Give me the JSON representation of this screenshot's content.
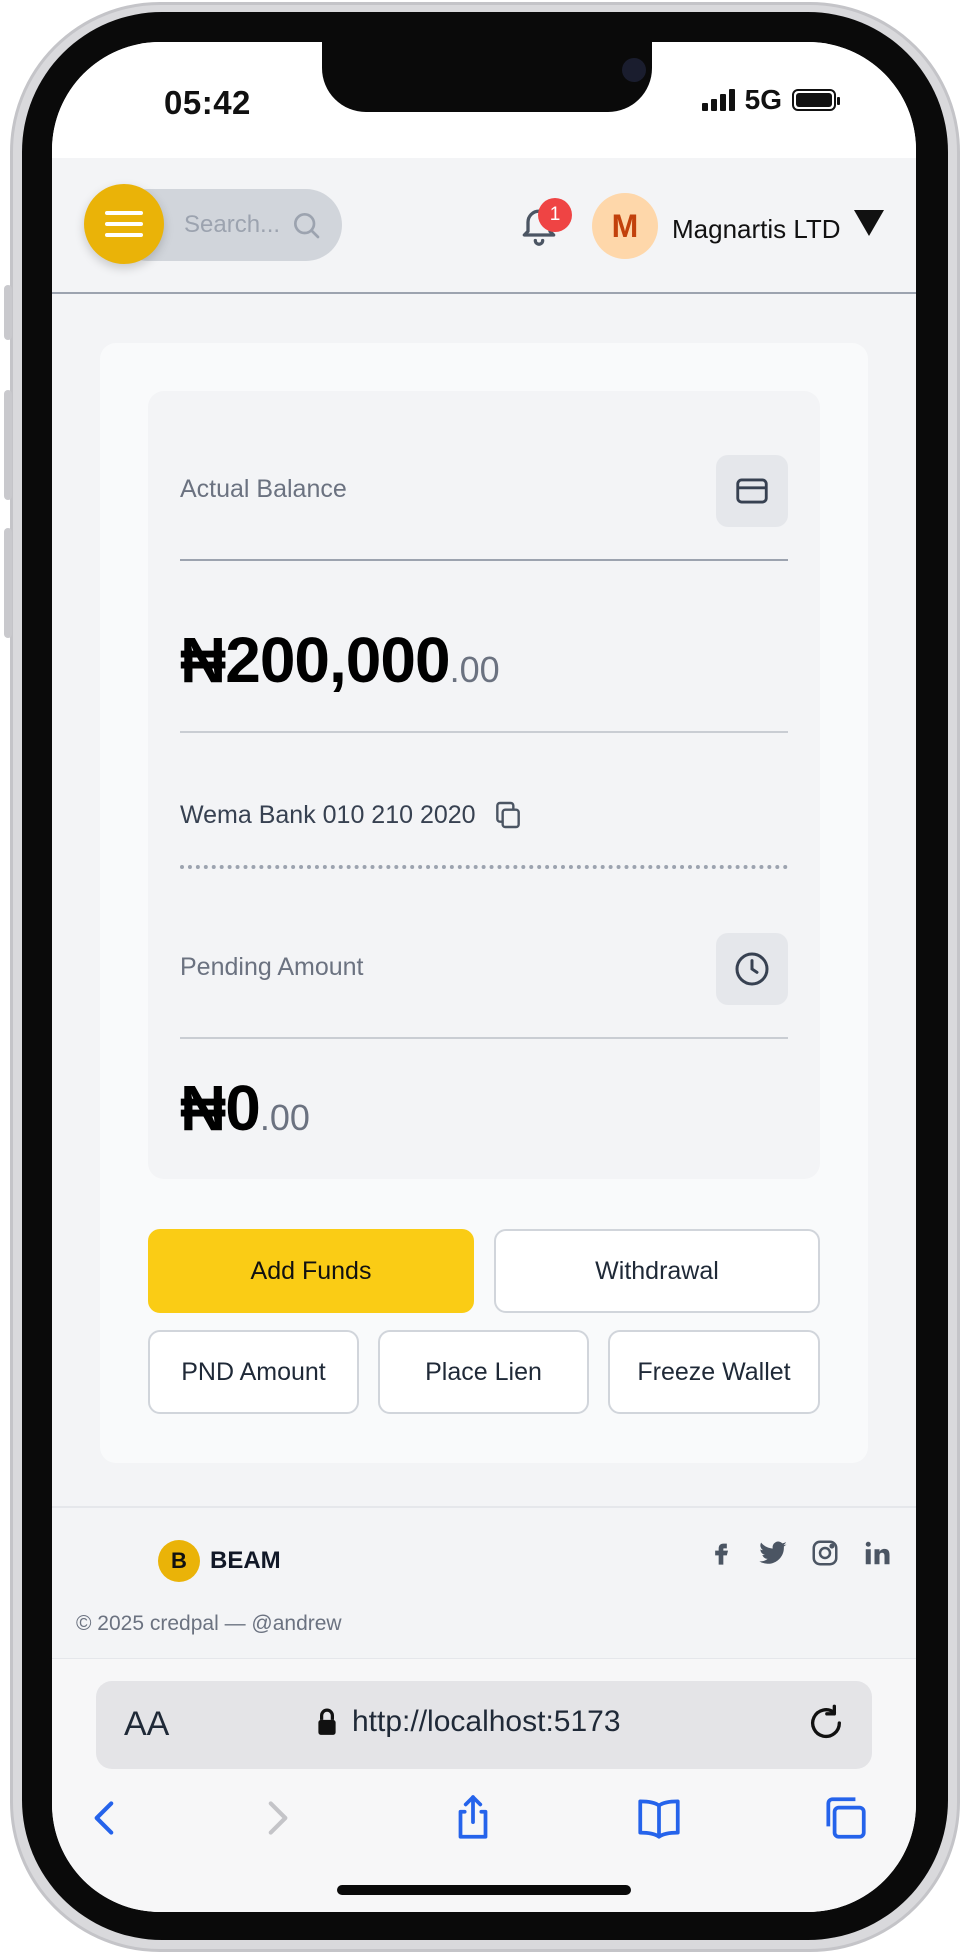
{
  "status_bar": {
    "time": "05:42",
    "network": "5G"
  },
  "header": {
    "search_placeholder": "Search...",
    "notification_count": "1",
    "avatar_initial": "M",
    "company_name": "Magnartis LTD"
  },
  "wallet": {
    "actual_balance_label": "Actual Balance",
    "actual_balance_main": "₦200,000",
    "actual_balance_cents": ".00",
    "bank_account": "Wema Bank 010 210 2020",
    "pending_label": "Pending Amount",
    "pending_main": "₦0",
    "pending_cents": ".00"
  },
  "actions": {
    "add_funds": "Add Funds",
    "withdrawal": "Withdrawal",
    "pnd_amount": "PND Amount",
    "place_lien": "Place Lien",
    "freeze_wallet": "Freeze Wallet"
  },
  "footer": {
    "brand_initial": "B",
    "brand_name": "BEAM",
    "copyright": "© 2025 credpal — @andrew",
    "socials": [
      "facebook-icon",
      "twitter-icon",
      "instagram-icon",
      "linkedin-icon"
    ]
  },
  "browser": {
    "text_size_label": "AA",
    "url": "http://localhost:5173"
  },
  "colors": {
    "accent": "#facc15",
    "menu": "#eab308",
    "badge": "#ef4444",
    "link_blue": "#2563eb"
  }
}
